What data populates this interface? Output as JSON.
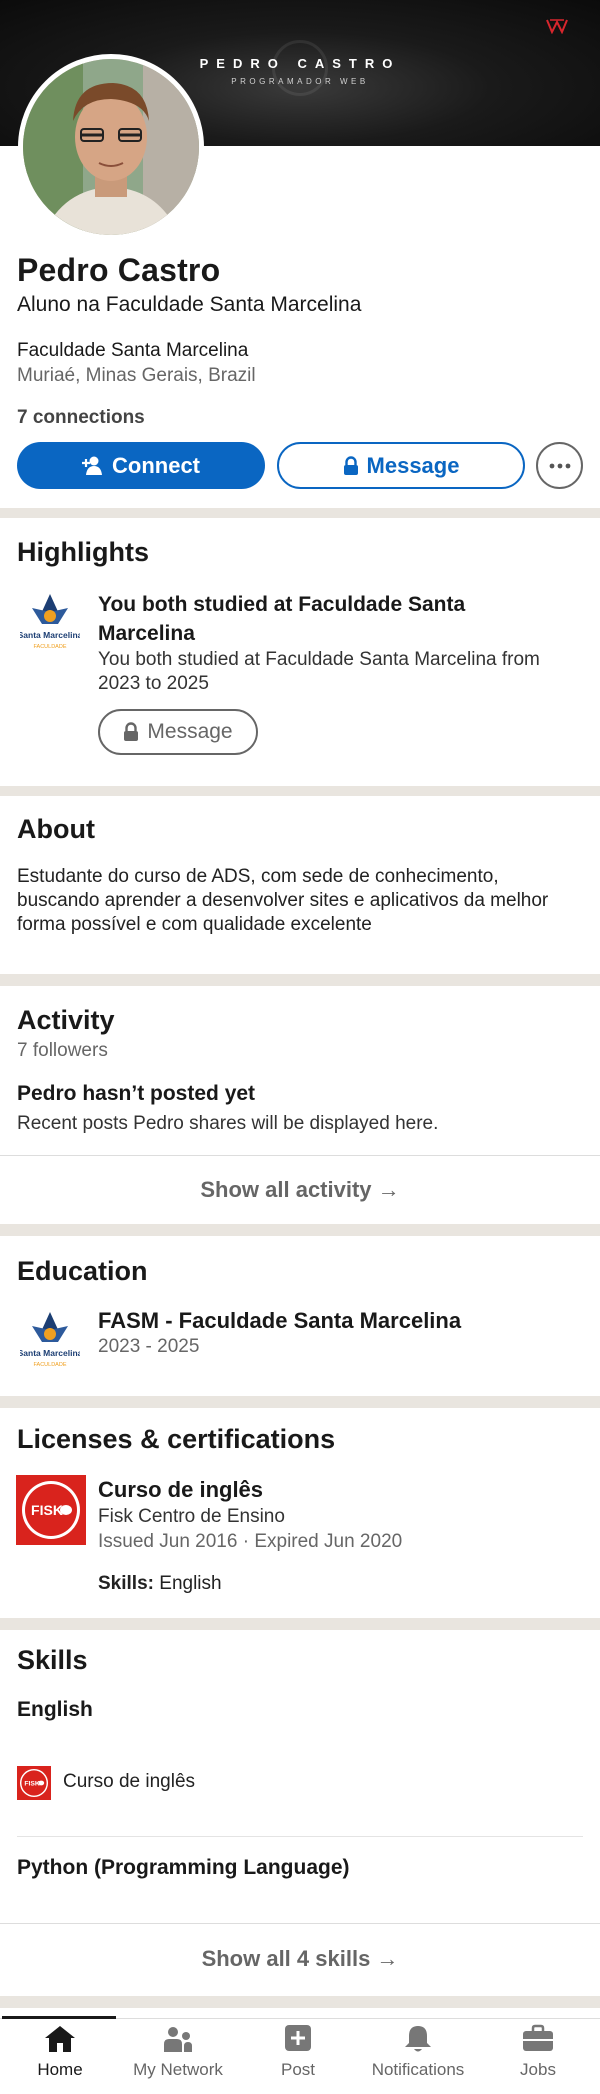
{
  "banner": {
    "name": "PEDRO CASTRO",
    "subtitle": "PROGRAMADOR WEB"
  },
  "profile": {
    "name": "Pedro Castro",
    "headline": "Aluno na Faculdade Santa Marcelina",
    "school": "Faculdade Santa Marcelina",
    "location": "Muriaé, Minas Gerais, Brazil",
    "connections": "7 connections"
  },
  "actions": {
    "connect": "Connect",
    "message": "Message"
  },
  "highlights": {
    "title": "Highlights",
    "item_title": "You both studied at Faculdade Santa Marcelina",
    "item_desc": "You both studied at Faculdade Santa Marcelina from 2023 to 2025",
    "message_label": "Message"
  },
  "school_logo": {
    "line1": "Santa Marcelina",
    "line2": "FACULDADE"
  },
  "about": {
    "title": "About",
    "text": "Estudante do curso de ADS, com sede de conhecimento, buscando aprender a desenvolver sites e aplicativos da melhor forma possível e com qualidade excelente"
  },
  "activity": {
    "title": "Activity",
    "followers": "7 followers",
    "empty_title": "Pedro hasn’t posted yet",
    "empty_desc": "Recent posts Pedro shares will be displayed here.",
    "show_all": "Show all activity →"
  },
  "education": {
    "title": "Education",
    "school": "FASM - Faculdade Santa Marcelina",
    "dates": "2023 - 2025"
  },
  "licenses": {
    "title": "Licenses & certifications",
    "logo_text": "FISK",
    "name": "Curso de inglês",
    "org": "Fisk Centro de Ensino",
    "issued": "Issued Jun 2016 · Expired Jun 2020",
    "skills_label": "Skills:",
    "skills_value": "English"
  },
  "skills": {
    "title": "Skills",
    "items": [
      {
        "name": "English",
        "cert": "Curso de inglês"
      },
      {
        "name": "Python (Programming Language)"
      }
    ],
    "show_all": "Show all 4 skills →"
  },
  "nav": [
    {
      "label": "Home",
      "icon": "home-icon",
      "active": true
    },
    {
      "label": "My Network",
      "icon": "people-icon"
    },
    {
      "label": "Post",
      "icon": "plus-square-icon"
    },
    {
      "label": "Notifications",
      "icon": "bell-icon"
    },
    {
      "label": "Jobs",
      "icon": "briefcase-icon"
    }
  ],
  "colors": {
    "primary": "#0a66c2",
    "separator": "#e9e5df",
    "fisk_red": "#d9231d"
  }
}
